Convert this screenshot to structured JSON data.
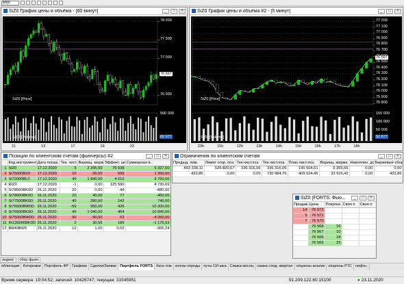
{
  "toolbar": {
    "interval": "M60"
  },
  "chart1": {
    "title": "SiZ0 График цены и объёма - [60 минут]",
    "price_legend": "SiZ0 [Price]",
    "volume_legend": "SiZ0 [Volume]",
    "yticks": [
      "78 000",
      "77 500",
      "77 000",
      "76 500",
      "76 000"
    ],
    "price_tag": "76 567",
    "vol_ticks": [
      "500 000",
      "0"
    ],
    "vol_tag": "82 977",
    "xticks": [
      "11",
      "13",
      "17",
      "19",
      "23"
    ]
  },
  "chart2": {
    "title": "SiZ0 График цены и объёма #2 - [5 минут]",
    "price_legend": "SiZ0 [Price]",
    "volume_legend": "SiZ0 [Volume]",
    "yticks": [
      "77 200",
      "77 100",
      "77 000",
      "76 900",
      "76 800",
      "76 700",
      "76 600",
      "76 500",
      "76 400",
      "76 300",
      "76 200",
      "76 100",
      "76 000",
      "75 900",
      "75 800"
    ],
    "price_tag": "76 567",
    "vol_ticks": [
      "150 000",
      "100 000",
      "50 000",
      "0"
    ],
    "vol_tag": "52 877",
    "xticks": [
      "23h",
      "11h",
      "12h",
      "13h",
      "14h",
      "15h",
      "16h",
      "17h",
      "18h"
    ]
  },
  "positions": {
    "title": "Позиции по клиентским счетам (фьючерсы) #2",
    "headers": [
      "Код инструмента",
      "Дата погаш.",
      "Тек. чист.поз.",
      "Вариац. маржа",
      "Эффект. цена",
      "Суммарная в."
    ],
    "rows": [
      [
        "SiZ0",
        "17.12.2020",
        "5",
        "2 295,00",
        "76 538",
        "5 327,00"
      ],
      [
        "Si75000BX0",
        "17.12.2020",
        "10",
        "-30,00",
        "506",
        "1 350,00"
      ],
      [
        "Si72000BL0",
        "17.12.2020",
        "40",
        "1 840,00",
        "4 610",
        "9 760,00"
      ],
      [
        "RIZ0",
        "17.12.2020",
        "-1",
        "0,00",
        "125 590",
        "4 730,69"
      ],
      [
        "Si78500BK0D",
        "26.11.2020",
        "20",
        "0,00",
        "44",
        "-880,00"
      ],
      [
        "Si78000BK0D",
        "26.11.2020",
        "20",
        "40,00",
        "77",
        "-460,00"
      ],
      [
        "Si77500BK0D",
        "26.11.2020",
        "40",
        "280,00",
        "142",
        "740,00"
      ],
      [
        "Si76500BW0D",
        "26.11.2020",
        "-50",
        "950,00",
        "426",
        "10 300,00"
      ],
      [
        "Si76500BK0D",
        "26.11.2020",
        "40",
        "1 040,00",
        "464",
        "10 840,00"
      ],
      [
        "Si75000BW0D",
        "26.11.2020",
        "90",
        "-90,00",
        "52",
        "-4 050,00"
      ],
      [
        "RI130000BK0D",
        "26.11.2020",
        "2",
        "30,56",
        "180",
        "-1 175,03"
      ],
      [
        "BR40BW0",
        "25.11.2020",
        "12",
        "1,00",
        "0,02",
        "-366,24"
      ]
    ],
    "row_nums": [
      "1",
      "2",
      "3",
      "4",
      "5",
      "6",
      "7",
      "8",
      "9",
      "10",
      "11",
      "12"
    ],
    "row_classes": [
      "g",
      "r",
      "g",
      "w",
      "w",
      "g",
      "g",
      "g",
      "g",
      "r",
      "g",
      "w"
    ]
  },
  "limits": {
    "title": "Ограничения по клиентским счетам",
    "headers": [
      "Предыд. лим.",
      "Лимит откр. поз.",
      "Тек.чист.поз.",
      "Тек.чист.поз.",
      "План.чист.поз.",
      "Вариац. маржа",
      "Накоплен. доход",
      "Биржевые сборы"
    ],
    "rows": [
      [
        "493 338,11",
        "526 820,67",
        "336 316,06",
        "336 316,06",
        "190 504,61",
        "6 355,56",
        "0,00",
        "0,00"
      ],
      [
        "433,86",
        "0,00",
        "0,00",
        "730 984,76",
        "409 624,45",
        "33 916,42",
        "0,00",
        "433,86"
      ]
    ]
  },
  "orderbook": {
    "title": "SiZ0 [FORTS: Фью...",
    "headers": [
      "Продаж",
      "Цена",
      "Покупка",
      "Своя п",
      "Своя п"
    ],
    "rows": [
      [
        "14",
        "76 572",
        "",
        "",
        ""
      ],
      [
        "9",
        "76 571",
        "",
        "",
        ""
      ],
      [
        "7",
        "76 570",
        "",
        "",
        ""
      ],
      [
        "",
        "76 568",
        "16",
        "",
        ""
      ],
      [
        "",
        "76 567",
        "10",
        "",
        ""
      ],
      [
        "",
        "76 566",
        "18",
        "",
        ""
      ],
      [
        "",
        "76 565",
        "25",
        "",
        ""
      ]
    ]
  },
  "mini_tabs": [
    "яндекс",
    "сбер фьюч"
  ],
  "tabs": [
    "облигации",
    "Котировки",
    "Портфель ФР",
    "Графики",
    "Сделки/Заявки",
    "Портфель FORTS",
    "баск-том",
    "холлы-спреды",
    "путы СИ-шка",
    "Сишка месяц",
    "сишка след. квартал",
    "опционы анализ",
    "опционы РТС",
    "нефть-"
  ],
  "active_tab": 5,
  "status": {
    "server_time": "Время сервера: 19:04:52; записей: 10426747; текущая: 31545951",
    "ip": "91.209.122.60:15100",
    "date": "23.11.2020"
  },
  "chart1_data": {
    "type": "candlestick",
    "close": [
      76300,
      76550,
      76700,
      76800,
      76650,
      76900,
      77200,
      77050,
      77350,
      77550,
      77650,
      77750,
      77700,
      77950,
      77800,
      77600,
      77650,
      77400,
      77200,
      77450,
      77300,
      77100,
      76950,
      77150,
      77000,
      76850,
      76650,
      76700,
      76900,
      76750,
      76600,
      76800,
      76500,
      76450,
      76700,
      76650,
      76300,
      76150,
      76100,
      76400,
      76550,
      76350,
      76450,
      76300,
      76200,
      76400,
      76100,
      76000,
      76300,
      76050,
      76200,
      76300,
      76100,
      75950,
      76150,
      76250,
      76350,
      76550,
      76450,
      76567
    ]
  },
  "chart2_data": {
    "type": "line",
    "close": [
      76260,
      76230,
      76200,
      76180,
      76120,
      75990,
      75900,
      75880,
      75870,
      75950,
      76020,
      76010,
      75990,
      76050,
      76060,
      76120,
      76170,
      76200,
      76150,
      76170,
      76150,
      76100,
      76120,
      76200,
      76160,
      76120,
      76180,
      76150,
      76220,
      76160,
      76180,
      76140,
      76110,
      76090,
      76090,
      76180,
      76310,
      76400,
      76500,
      76567
    ]
  }
}
